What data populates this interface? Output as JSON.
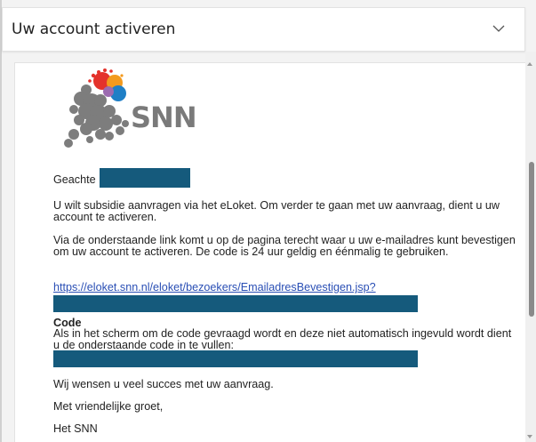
{
  "header": {
    "title": "Uw account activeren",
    "chevron_icon": "chevron-down-icon"
  },
  "logo": {
    "brand_text": "SNN",
    "icon": "snn-logo-icon"
  },
  "email": {
    "greeting": "Geachte",
    "paragraph1": "U wilt subsidie aanvragen via het eLoket. Om verder te gaan met uw aanvraag, dient u uw account te activeren.",
    "paragraph2": "Via de onderstaande link komt u op de pagina terecht waar u uw e-mailadres kunt bevestigen om uw account te activeren. De code is 24 uur geldig en éénmalig te gebruiken.",
    "link_text": "https://eloket.snn.nl/eloket/bezoekers/EmailadresBevestigen.jsp?",
    "code_heading": "Code",
    "code_paragraph": "Als in het scherm om de code gevraagd wordt en deze niet automatisch ingevuld wordt dient u de onderstaande code in te vullen:",
    "closing1": "Wij wensen u veel succes met uw aanvraag.",
    "closing2": "Met vriendelijke groet,",
    "signature": "Het SNN"
  },
  "colors": {
    "redaction": "#155a7c",
    "link": "#2a4fb5",
    "logo_gray": "#7a7a7a",
    "logo_red": "#e4322b",
    "logo_orange": "#f39a1e",
    "logo_blue": "#1f7fc6"
  }
}
